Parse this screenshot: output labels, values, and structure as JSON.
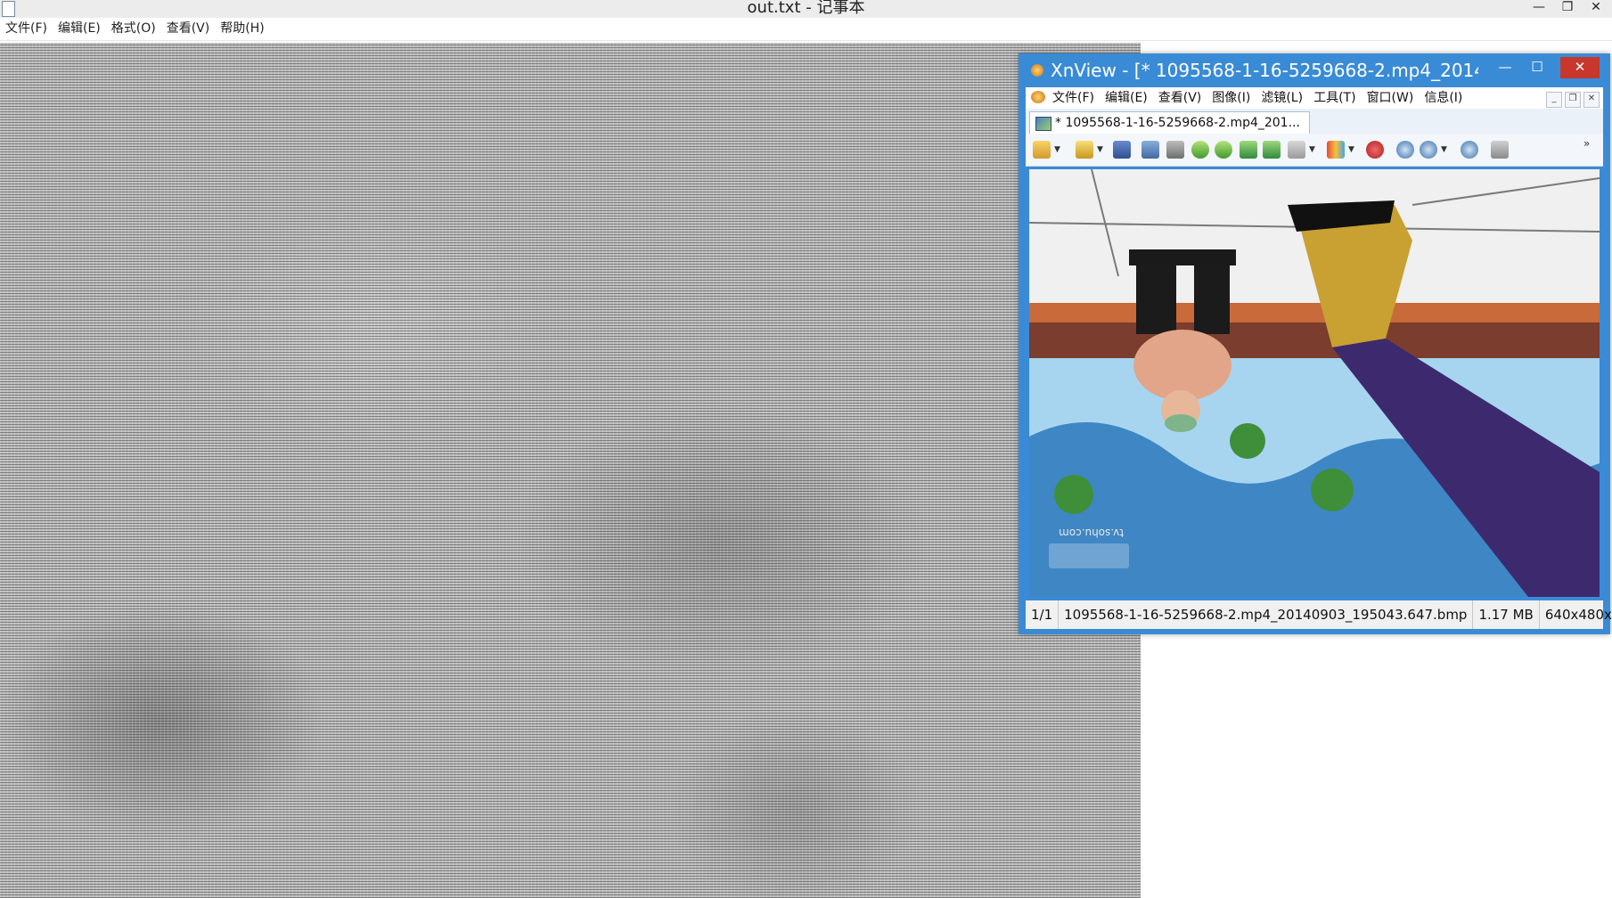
{
  "notepad": {
    "title": "out.txt - 记事本",
    "minimize": "—",
    "maximize": "❐",
    "menu": [
      "文件(F)",
      "编辑(E)",
      "格式(O)",
      "查看(V)",
      "帮助(H)"
    ]
  },
  "xnview": {
    "title": "XnView - [* 1095568-1-16-5259668-2.mp4_2014...",
    "minimize": "—",
    "maximize": "☐",
    "close": "✕",
    "menu": [
      "文件(F)",
      "编辑(E)",
      "查看(V)",
      "图像(I)",
      "滤镜(L)",
      "工具(T)",
      "窗口(W)",
      "信息(I)"
    ],
    "mdi_buttons": [
      "_",
      "❐",
      "✕"
    ],
    "tab_label": "* 1095568-1-16-5259668-2.mp4_201...",
    "toolbar_icons": [
      "browser-icon",
      "open-folder-icon",
      "save-icon",
      "undo-icon",
      "crop-icon",
      "rotate-left-icon",
      "rotate-right-icon",
      "export-icon",
      "import-icon",
      "adjust-icon",
      "palette-icon",
      "effects-icon",
      "zoom-in-icon",
      "zoom-dropdown-icon",
      "zoom-out-icon",
      "back-icon"
    ],
    "image_watermark": "tv.sohu.com",
    "status": {
      "index": "1/1",
      "filename": "1095568-1-16-5259668-2.mp4_20140903_195043.647.bmp",
      "size": "1.17 MB",
      "dimensions": "640x480x"
    }
  }
}
